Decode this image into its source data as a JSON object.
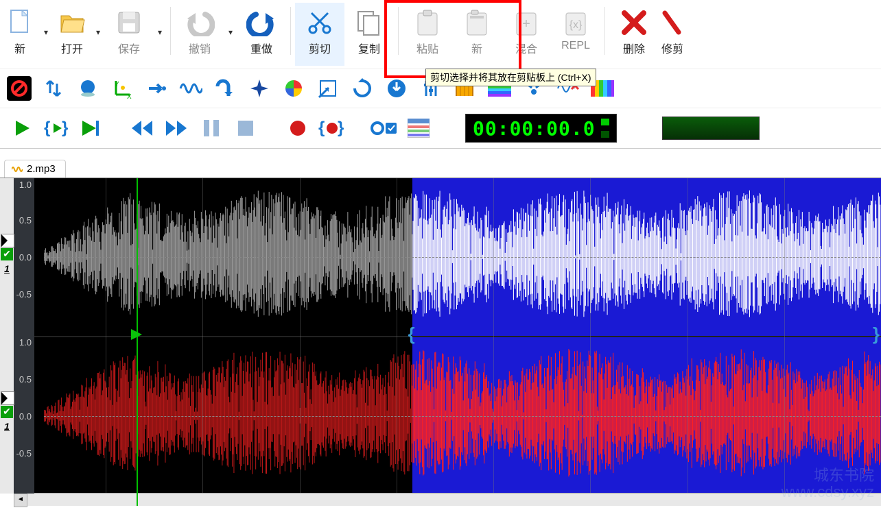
{
  "toolbar": {
    "new": "新",
    "open": "打开",
    "save": "保存",
    "undo": "撤销",
    "redo": "重做",
    "cut": "剪切",
    "copy": "复制",
    "paste": "粘贴",
    "new2": "新",
    "mix": "混合",
    "repl": "REPL",
    "delete": "删除",
    "trim": "修剪"
  },
  "tooltip": {
    "cut": "剪切选择并将其放在剪贴板上 (Ctrl+X)"
  },
  "transport": {
    "time": "00:00:00.0"
  },
  "file": {
    "tab_name": "2.mp3"
  },
  "channels": {
    "left_id": "1",
    "right_id": "1"
  },
  "amp_labels": [
    "1.0",
    "0.5",
    "0.0",
    "-0.5"
  ],
  "watermark": {
    "line1": "城东书院",
    "line2": "www.cdsy.xyz"
  },
  "chart_data": {
    "type": "waveform",
    "file": "2.mp3",
    "channels": 2,
    "amplitude_range": [
      -1.0,
      1.0
    ],
    "amplitude_ticks": [
      1.0,
      0.5,
      0.0,
      -0.5
    ],
    "cursor_fraction": 0.12,
    "selection_fraction": [
      0.45,
      1.0
    ],
    "channel_colors": [
      "#cccccc",
      "#ff2020"
    ],
    "selection_overlay_color": "#1a1ad4"
  }
}
